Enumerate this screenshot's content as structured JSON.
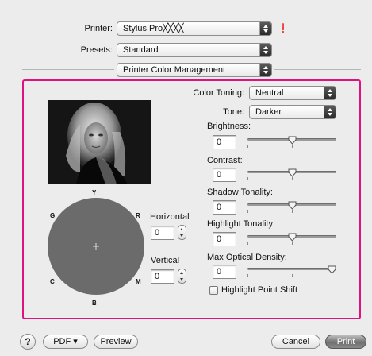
{
  "header": {
    "printer_label": "Printer:",
    "printer_value": "Stylus Pro╳╳╳╳",
    "presets_label": "Presets:",
    "presets_value": "Standard",
    "panel_value": "Printer Color Management"
  },
  "settings": {
    "color_toning_label": "Color Toning:",
    "color_toning_value": "Neutral",
    "tone_label": "Tone:",
    "tone_value": "Darker",
    "brightness_label": "Brightness:",
    "brightness_value": "0",
    "contrast_label": "Contrast:",
    "contrast_value": "0",
    "shadow_label": "Shadow Tonality:",
    "shadow_value": "0",
    "highlight_label": "Highlight Tonality:",
    "highlight_value": "0",
    "maxdensity_label": "Max Optical Density:",
    "maxdensity_value": "0",
    "highlight_shift_label": "Highlight Point Shift"
  },
  "sliders": {
    "brightness_level": 0.5,
    "contrast_level": 0.5,
    "shadow_level": 0.5,
    "highlight_level": 0.5,
    "maxdensity_level": 1.0
  },
  "color_wheel": {
    "y": "Y",
    "r": "R",
    "m": "M",
    "b": "B",
    "c": "C",
    "g": "G",
    "horizontal_label": "Horizontal",
    "horizontal_value": "0",
    "vertical_label": "Vertical",
    "vertical_value": "0"
  },
  "footer": {
    "help": "?",
    "pdf": "PDF ▾",
    "preview": "Preview",
    "cancel": "Cancel",
    "print": "Print"
  },
  "colors": {
    "highlight_border": "#e0127f",
    "wheel": "#6b6b6b",
    "default_button": "#7a7a7a"
  },
  "icons": {
    "info": "warning-icon",
    "popup_arrows": "popup-arrows-icon",
    "stepper": "stepper-icon",
    "slider_thumb": "slider-thumb-icon",
    "crosshair": "crosshair-icon"
  }
}
